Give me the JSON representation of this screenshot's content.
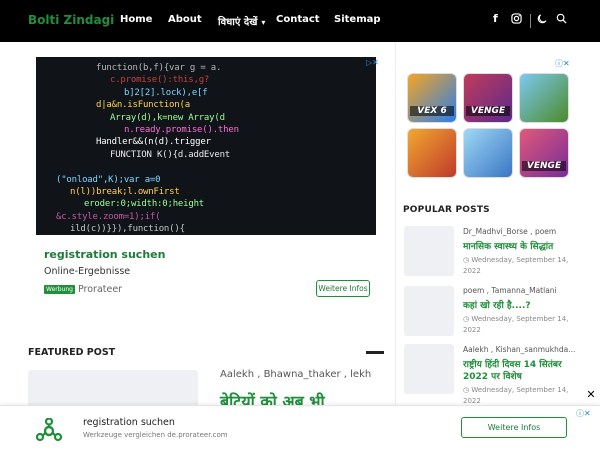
{
  "header": {
    "logo": "Bolti Zindagi",
    "nav": [
      {
        "label": "Home"
      },
      {
        "label": "About"
      },
      {
        "label": "विधाएं देखें"
      },
      {
        "label": "Contact"
      },
      {
        "label": "Sitemap"
      }
    ],
    "icons": [
      "facebook-icon",
      "instagram-icon",
      "dark-mode-icon",
      "search-icon"
    ]
  },
  "colors": {
    "brand_green": "#1f8f3a",
    "header_bg": "#000000",
    "link_blue": "#1e88e5"
  },
  "top_ad": {
    "code_lines": [
      "function(b,f){var g = a.",
      "c.promise():this,g?",
      "b]2[2].lock),e[f",
      "d|a&n.isFunction(a",
      "Array(d),k=new Array(d",
      "n.ready.promise().then",
      "Handler&&(n(d).trigger",
      "FUNCTION K(){d.addEvent",
      "",
      "(\"onload\",K);var a=0",
      "n(l))break;l.ownFirst",
      "eroder:0;width:0;height",
      "&c.style.zoom=1);if(",
      "ild(c))}}),function(){"
    ],
    "title": "registration suchen",
    "subtitle": "Online-Ergebnisse",
    "brand": "Prorateer",
    "brand_flag": "Werbung",
    "button": "Weitere Infos"
  },
  "featured": {
    "heading": "FEATURED POST",
    "tags": "Aalekh , Bhawna_thaker , lekh",
    "title": "बेटियों को अब भी"
  },
  "games": [
    {
      "label": "VEX 6",
      "colors": [
        "#f5a623",
        "#2b7de9"
      ]
    },
    {
      "label": "VENGE",
      "colors": [
        "#c23b5b",
        "#5a2a8a"
      ]
    },
    {
      "label": "",
      "colors": [
        "#7dc8f0",
        "#4c8b2a"
      ]
    },
    {
      "label": "",
      "colors": [
        "#f0a830",
        "#c0392b"
      ]
    },
    {
      "label": "",
      "colors": [
        "#9fd8f5",
        "#3a76c4"
      ]
    },
    {
      "label": "VENGE",
      "colors": [
        "#e05a7a",
        "#7a2b9a"
      ]
    }
  ],
  "popular": {
    "heading": "POPULAR POSTS",
    "posts": [
      {
        "tags": "Dr_Madhvi_Borse , poem",
        "title": "मानसिक स्वास्थ्य के सिद्धांत",
        "date": "Wednesday, September 14, 2022"
      },
      {
        "tags": "poem , Tamanna_Matlani",
        "title": "कहां खो रही है....?",
        "date": "Wednesday, September 14, 2022"
      },
      {
        "tags": "Aalekh , Kishan_sanmukhda...",
        "title": "राष्ट्रीय हिंदी दिवस 14 सितंबर",
        "title2": "2022 पर विशेष",
        "date": "Wednesday, September 14, 2022"
      }
    ]
  },
  "bottom_ad": {
    "title": "registration suchen",
    "subtitle": "Werkzeuge vergleichen de.prorateer.com",
    "button": "Weitere Infos"
  }
}
